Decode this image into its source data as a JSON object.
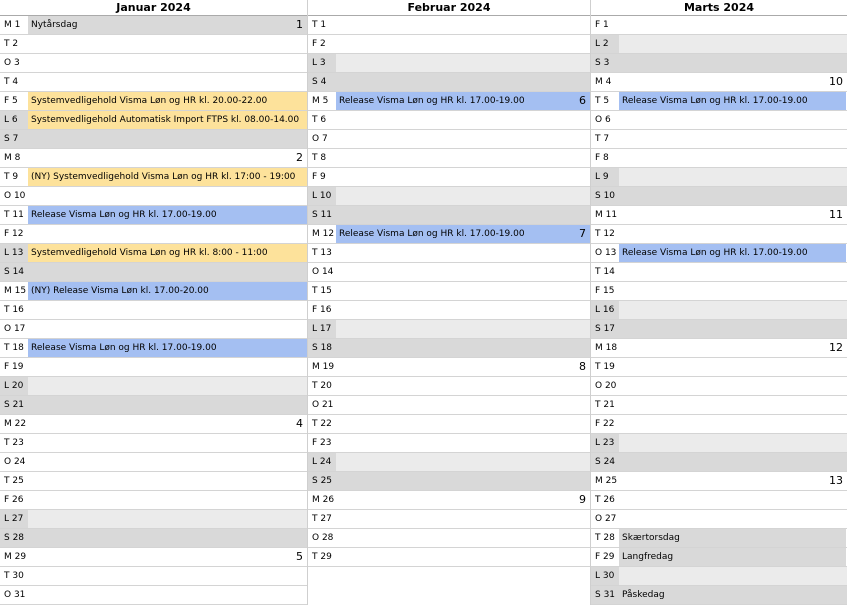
{
  "colors": {
    "yellow": "#fde29b",
    "blue": "#a4bff2",
    "weekend": "#d9d9d9"
  },
  "months": [
    {
      "title": "Januar 2024",
      "days": [
        {
          "label": "M  1",
          "event": "Nytårsdag",
          "color": "gray",
          "week": "1"
        },
        {
          "label": "T  2"
        },
        {
          "label": "O  3"
        },
        {
          "label": "T  4"
        },
        {
          "label": "F  5",
          "event": "Systemvedligehold Visma Løn og HR kl. 20.00-22.00",
          "color": "yellow"
        },
        {
          "label": "L  6",
          "event": "Systemvedligehold Automatisk Import FTPS kl. 08.00-14.00",
          "color": "yellow",
          "weekend": true
        },
        {
          "label": "S  7",
          "weekend": true,
          "sunday": true
        },
        {
          "label": "M  8",
          "week": "2"
        },
        {
          "label": "T  9",
          "event": "(NY) Systemvedligehold Visma Løn og HR kl. 17:00 - 19:00",
          "color": "yellow"
        },
        {
          "label": "O 10"
        },
        {
          "label": "T 11",
          "event": "Release Visma Løn og HR kl. 17.00-19.00",
          "color": "blue"
        },
        {
          "label": "F 12"
        },
        {
          "label": "L 13",
          "event": "Systemvedligehold Visma Løn og HR kl. 8:00 - 11:00",
          "color": "yellow",
          "weekend": true
        },
        {
          "label": "S 14",
          "weekend": true,
          "sunday": true
        },
        {
          "label": "M 15",
          "event": "(NY) Release Visma Løn kl. 17.00-20.00",
          "color": "blue"
        },
        {
          "label": "T 16"
        },
        {
          "label": "O 17"
        },
        {
          "label": "T 18",
          "event": "Release Visma Løn og HR kl. 17.00-19.00",
          "color": "blue"
        },
        {
          "label": "F 19"
        },
        {
          "label": "L 20",
          "weekend": true
        },
        {
          "label": "S 21",
          "weekend": true,
          "sunday": true
        },
        {
          "label": "M 22",
          "week": "4"
        },
        {
          "label": "T 23"
        },
        {
          "label": "O 24"
        },
        {
          "label": "T 25"
        },
        {
          "label": "F 26"
        },
        {
          "label": "L 27",
          "weekend": true
        },
        {
          "label": "S 28",
          "weekend": true,
          "sunday": true
        },
        {
          "label": "M 29",
          "week": "5"
        },
        {
          "label": "T 30"
        },
        {
          "label": "O 31"
        }
      ]
    },
    {
      "title": "Februar 2024",
      "days": [
        {
          "label": "T  1"
        },
        {
          "label": "F  2"
        },
        {
          "label": "L  3",
          "weekend": true
        },
        {
          "label": "S  4",
          "weekend": true,
          "sunday": true
        },
        {
          "label": "M  5",
          "event": "Release Visma Løn og HR kl. 17.00-19.00",
          "color": "blue",
          "week": "6"
        },
        {
          "label": "T  6"
        },
        {
          "label": "O  7"
        },
        {
          "label": "T  8"
        },
        {
          "label": "F  9"
        },
        {
          "label": "L 10",
          "weekend": true
        },
        {
          "label": "S 11",
          "weekend": true,
          "sunday": true
        },
        {
          "label": "M 12",
          "event": "Release Visma Løn og HR kl. 17.00-19.00",
          "color": "blue",
          "week": "7"
        },
        {
          "label": "T 13"
        },
        {
          "label": "O 14"
        },
        {
          "label": "T 15"
        },
        {
          "label": "F 16"
        },
        {
          "label": "L 17",
          "weekend": true
        },
        {
          "label": "S 18",
          "weekend": true,
          "sunday": true
        },
        {
          "label": "M 19",
          "week": "8"
        },
        {
          "label": "T 20"
        },
        {
          "label": "O 21"
        },
        {
          "label": "T 22"
        },
        {
          "label": "F 23"
        },
        {
          "label": "L 24",
          "weekend": true
        },
        {
          "label": "S 25",
          "weekend": true,
          "sunday": true
        },
        {
          "label": "M 26",
          "week": "9"
        },
        {
          "label": "T 27"
        },
        {
          "label": "O 28"
        },
        {
          "label": "T 29"
        }
      ]
    },
    {
      "title": "Marts 2024",
      "days": [
        {
          "label": "F  1"
        },
        {
          "label": "L  2",
          "weekend": true
        },
        {
          "label": "S  3",
          "weekend": true,
          "sunday": true
        },
        {
          "label": "M  4",
          "week": "10"
        },
        {
          "label": "T  5",
          "event": "Release Visma Løn og HR kl. 17.00-19.00",
          "color": "blue"
        },
        {
          "label": "O  6"
        },
        {
          "label": "T  7"
        },
        {
          "label": "F  8"
        },
        {
          "label": "L  9",
          "weekend": true
        },
        {
          "label": "S 10",
          "weekend": true,
          "sunday": true
        },
        {
          "label": "M 11",
          "week": "11"
        },
        {
          "label": "T 12"
        },
        {
          "label": "O 13",
          "event": "Release Visma Løn og HR kl. 17.00-19.00",
          "color": "blue"
        },
        {
          "label": "T 14"
        },
        {
          "label": "F 15"
        },
        {
          "label": "L 16",
          "weekend": true
        },
        {
          "label": "S 17",
          "weekend": true,
          "sunday": true
        },
        {
          "label": "M 18",
          "week": "12"
        },
        {
          "label": "T 19"
        },
        {
          "label": "O 20"
        },
        {
          "label": "T 21"
        },
        {
          "label": "F 22"
        },
        {
          "label": "L 23",
          "weekend": true
        },
        {
          "label": "S 24",
          "weekend": true,
          "sunday": true
        },
        {
          "label": "M 25",
          "week": "13"
        },
        {
          "label": "T 26"
        },
        {
          "label": "O 27"
        },
        {
          "label": "T 28",
          "event": "Skærtorsdag",
          "color": "gray"
        },
        {
          "label": "F 29",
          "event": "Langfredag",
          "color": "gray"
        },
        {
          "label": "L 30",
          "weekend": true
        },
        {
          "label": "S 31",
          "event": "Påskedag",
          "color": "gray",
          "weekend": true,
          "sunday": true
        }
      ]
    }
  ]
}
